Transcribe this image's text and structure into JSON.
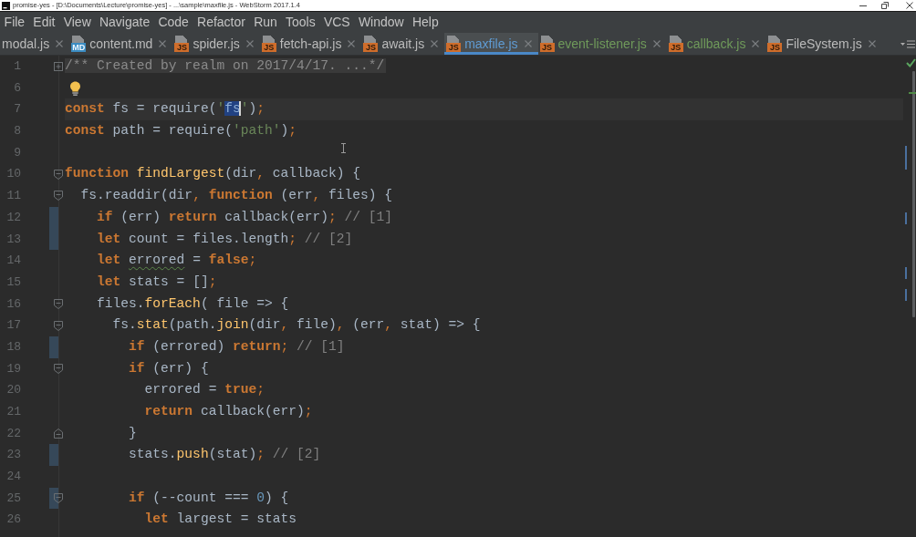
{
  "window": {
    "title": "promise-yes - [D:\\Documents\\Lecture\\promise-yes] - ...\\sample\\maxfile.js - WebStorm 2017.1.4"
  },
  "menu": [
    "File",
    "Edit",
    "View",
    "Navigate",
    "Code",
    "Refactor",
    "Run",
    "Tools",
    "VCS",
    "Window",
    "Help"
  ],
  "tabs": [
    {
      "label": "modal.js",
      "selected": false,
      "color": "#bbbbbb"
    },
    {
      "label": "content.md",
      "selected": false,
      "color": "#bbbbbb",
      "icon": {
        "kind": "md",
        "label": "MD"
      }
    },
    {
      "label": "spider.js",
      "selected": false,
      "color": "#bbbbbb",
      "icon": {
        "kind": "js",
        "label": "JS"
      }
    },
    {
      "label": "fetch-api.js",
      "selected": false,
      "color": "#bbbbbb",
      "icon": {
        "kind": "js",
        "label": "JS"
      }
    },
    {
      "label": "await.js",
      "selected": false,
      "color": "#bbbbbb",
      "icon": {
        "kind": "js",
        "label": "JS"
      }
    },
    {
      "label": "maxfile.js",
      "selected": true,
      "color": "#5f9bd3",
      "icon": {
        "kind": "js",
        "label": "JS"
      }
    },
    {
      "label": "event-listener.js",
      "selected": false,
      "color": "#6f9a5a",
      "icon": {
        "kind": "js",
        "label": "JS"
      }
    },
    {
      "label": "callback.js",
      "selected": false,
      "color": "#6f9a5a",
      "icon": {
        "kind": "js",
        "label": "JS"
      }
    },
    {
      "label": "FileSystem.js",
      "selected": false,
      "color": "#bbbbbb",
      "icon": {
        "kind": "js",
        "label": "JS"
      }
    }
  ],
  "code_lines": [
    {
      "number": "1",
      "fold": {
        "kind": "collapsed"
      },
      "changed": false,
      "current": false,
      "intention": false,
      "tokens": [
        {
          "kind": "folded",
          "text": "/** Created by realm on 2017/4/17. ...*/"
        }
      ]
    },
    {
      "number": "6",
      "changed": false,
      "current": false,
      "intention": true
    },
    {
      "number": "7",
      "changed": false,
      "current": true,
      "intention": false,
      "tokens": [
        {
          "kind": "keyword",
          "text": "const"
        },
        {
          "kind": "plain",
          "text": " fs = require("
        },
        {
          "kind": "string",
          "text": "'"
        },
        {
          "kind": "selection",
          "text": "fs"
        },
        {
          "kind": "string",
          "text": "'"
        },
        {
          "kind": "plain",
          "text": ")"
        },
        {
          "kind": "punct",
          "text": ";"
        }
      ]
    },
    {
      "number": "8",
      "changed": false,
      "current": false,
      "intention": false,
      "tokens": [
        {
          "kind": "keyword",
          "text": "const"
        },
        {
          "kind": "plain",
          "text": " path = require("
        },
        {
          "kind": "string",
          "text": "'path'"
        },
        {
          "kind": "plain",
          "text": ")"
        },
        {
          "kind": "punct",
          "text": ";"
        }
      ]
    },
    {
      "number": "9",
      "changed": false,
      "current": false,
      "intention": false
    },
    {
      "number": "10",
      "fold": {
        "kind": "start"
      },
      "changed": false,
      "current": false,
      "intention": false,
      "tokens": [
        {
          "kind": "keyword",
          "text": "function "
        },
        {
          "kind": "function",
          "text": "findLargest"
        },
        {
          "kind": "plain",
          "text": "(dir"
        },
        {
          "kind": "punct",
          "text": ","
        },
        {
          "kind": "plain",
          "text": " callback) {"
        }
      ]
    },
    {
      "number": "11",
      "fold": {
        "kind": "start"
      },
      "changed": false,
      "current": false,
      "intention": false,
      "tokens": [
        {
          "kind": "plain",
          "text": "  fs.readdir(dir"
        },
        {
          "kind": "punct",
          "text": ", "
        },
        {
          "kind": "keyword",
          "text": "function"
        },
        {
          "kind": "plain",
          "text": " (err"
        },
        {
          "kind": "punct",
          "text": ","
        },
        {
          "kind": "plain",
          "text": " files) {"
        }
      ]
    },
    {
      "number": "12",
      "changed": true,
      "current": false,
      "intention": false,
      "tokens": [
        {
          "kind": "keyword",
          "text": "    if"
        },
        {
          "kind": "plain",
          "text": " (err) "
        },
        {
          "kind": "keyword",
          "text": "return"
        },
        {
          "kind": "plain",
          "text": " callback(err)"
        },
        {
          "kind": "punct",
          "text": ";"
        },
        {
          "kind": "comment",
          "text": " // [1]"
        }
      ]
    },
    {
      "number": "13",
      "changed": true,
      "current": false,
      "intention": false,
      "tokens": [
        {
          "kind": "keyword",
          "text": "    let"
        },
        {
          "kind": "plain",
          "text": " count = files.length"
        },
        {
          "kind": "punct",
          "text": ";"
        },
        {
          "kind": "comment",
          "text": " // [2]"
        }
      ]
    },
    {
      "number": "14",
      "changed": false,
      "current": false,
      "intention": false,
      "tokens": [
        {
          "kind": "keyword",
          "text": "    let "
        },
        {
          "kind": "warning",
          "text": "errored"
        },
        {
          "kind": "plain",
          "text": " = "
        },
        {
          "kind": "keyword",
          "text": "false"
        },
        {
          "kind": "punct",
          "text": ";"
        }
      ]
    },
    {
      "number": "15",
      "changed": false,
      "current": false,
      "intention": false,
      "tokens": [
        {
          "kind": "keyword",
          "text": "    let"
        },
        {
          "kind": "plain",
          "text": " stats = []"
        },
        {
          "kind": "punct",
          "text": ";"
        }
      ]
    },
    {
      "number": "16",
      "fold": {
        "kind": "start"
      },
      "changed": false,
      "current": false,
      "intention": false,
      "tokens": [
        {
          "kind": "plain",
          "text": "    files."
        },
        {
          "kind": "function",
          "text": "forEach"
        },
        {
          "kind": "plain",
          "text": "( file => {"
        }
      ]
    },
    {
      "number": "17",
      "fold": {
        "kind": "start"
      },
      "changed": false,
      "current": false,
      "intention": false,
      "tokens": [
        {
          "kind": "plain",
          "text": "      fs."
        },
        {
          "kind": "function",
          "text": "stat"
        },
        {
          "kind": "plain",
          "text": "(path."
        },
        {
          "kind": "function",
          "text": "join"
        },
        {
          "kind": "plain",
          "text": "(dir"
        },
        {
          "kind": "punct",
          "text": ","
        },
        {
          "kind": "plain",
          "text": " file)"
        },
        {
          "kind": "punct",
          "text": ","
        },
        {
          "kind": "plain",
          "text": " (err"
        },
        {
          "kind": "punct",
          "text": ","
        },
        {
          "kind": "plain",
          "text": " stat) => {"
        }
      ]
    },
    {
      "number": "18",
      "changed": true,
      "current": false,
      "intention": false,
      "tokens": [
        {
          "kind": "keyword",
          "text": "        if"
        },
        {
          "kind": "plain",
          "text": " (errored) "
        },
        {
          "kind": "keyword",
          "text": "return"
        },
        {
          "kind": "punct",
          "text": ";"
        },
        {
          "kind": "comment",
          "text": " // [1]"
        }
      ]
    },
    {
      "number": "19",
      "fold": {
        "kind": "start"
      },
      "changed": false,
      "current": false,
      "intention": false,
      "tokens": [
        {
          "kind": "keyword",
          "text": "        if"
        },
        {
          "kind": "plain",
          "text": " (err) {"
        }
      ]
    },
    {
      "number": "20",
      "changed": false,
      "current": false,
      "intention": false,
      "tokens": [
        {
          "kind": "plain",
          "text": "          errored = "
        },
        {
          "kind": "keyword",
          "text": "true"
        },
        {
          "kind": "punct",
          "text": ";"
        }
      ]
    },
    {
      "number": "21",
      "changed": false,
      "current": false,
      "intention": false,
      "tokens": [
        {
          "kind": "keyword",
          "text": "          return"
        },
        {
          "kind": "plain",
          "text": " callback(err)"
        },
        {
          "kind": "punct",
          "text": ";"
        }
      ]
    },
    {
      "number": "22",
      "fold": {
        "kind": "end"
      },
      "changed": false,
      "current": false,
      "intention": false,
      "tokens": [
        {
          "kind": "plain",
          "text": "        }"
        }
      ]
    },
    {
      "number": "23",
      "changed": true,
      "current": false,
      "intention": false,
      "tokens": [
        {
          "kind": "plain",
          "text": "        stats."
        },
        {
          "kind": "function",
          "text": "push"
        },
        {
          "kind": "plain",
          "text": "(stat)"
        },
        {
          "kind": "punct",
          "text": ";"
        },
        {
          "kind": "comment",
          "text": " // [2]"
        }
      ]
    },
    {
      "number": "24",
      "changed": false,
      "current": false,
      "intention": false
    },
    {
      "number": "25",
      "fold": {
        "kind": "start"
      },
      "changed": true,
      "current": false,
      "intention": false,
      "tokens": [
        {
          "kind": "keyword",
          "text": "        if"
        },
        {
          "kind": "plain",
          "text": " (--count === "
        },
        {
          "kind": "number",
          "text": "0"
        },
        {
          "kind": "plain",
          "text": ") {"
        }
      ]
    },
    {
      "number": "26",
      "changed": false,
      "current": false,
      "intention": false,
      "tokens": [
        {
          "kind": "keyword",
          "text": "          let"
        },
        {
          "kind": "plain",
          "text": " largest = stats"
        }
      ]
    }
  ]
}
